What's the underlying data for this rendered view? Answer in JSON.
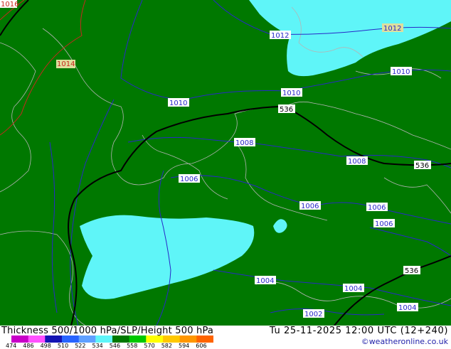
{
  "map": {
    "isobar_labels": [
      "1016",
      "1014",
      "1012",
      "1012",
      "1010",
      "1010",
      "1010",
      "1008",
      "1008",
      "1006",
      "1006",
      "1006",
      "1006",
      "1004",
      "1004",
      "1004",
      "1002"
    ],
    "thickness_labels": [
      "536",
      "536",
      "536"
    ],
    "colors": {
      "land_thickness": "#007800",
      "low_thickness": "#5ff5f8",
      "isobar": "#2828c8",
      "thickness_line": "#000000",
      "coast": "#b4b4b4",
      "high_isobar": "#c8281e"
    }
  },
  "footer": {
    "title": "Thickness 500/1000 hPa/SLP/Height 500 hPa",
    "valid_time": "Tu 25-11-2025 12:00 UTC (12+240)",
    "credit": "©weatheronline.co.uk",
    "scale_values": [
      "474",
      "486",
      "498",
      "510",
      "522",
      "534",
      "546",
      "558",
      "570",
      "582",
      "594",
      "606"
    ],
    "scale_colors": [
      "#c800c8",
      "#ff50ff",
      "#1414b4",
      "#2864ff",
      "#5fa0ff",
      "#5ff5f8",
      "#007800",
      "#00c800",
      "#ffff00",
      "#ffc800",
      "#ff9600",
      "#ff6400"
    ]
  }
}
